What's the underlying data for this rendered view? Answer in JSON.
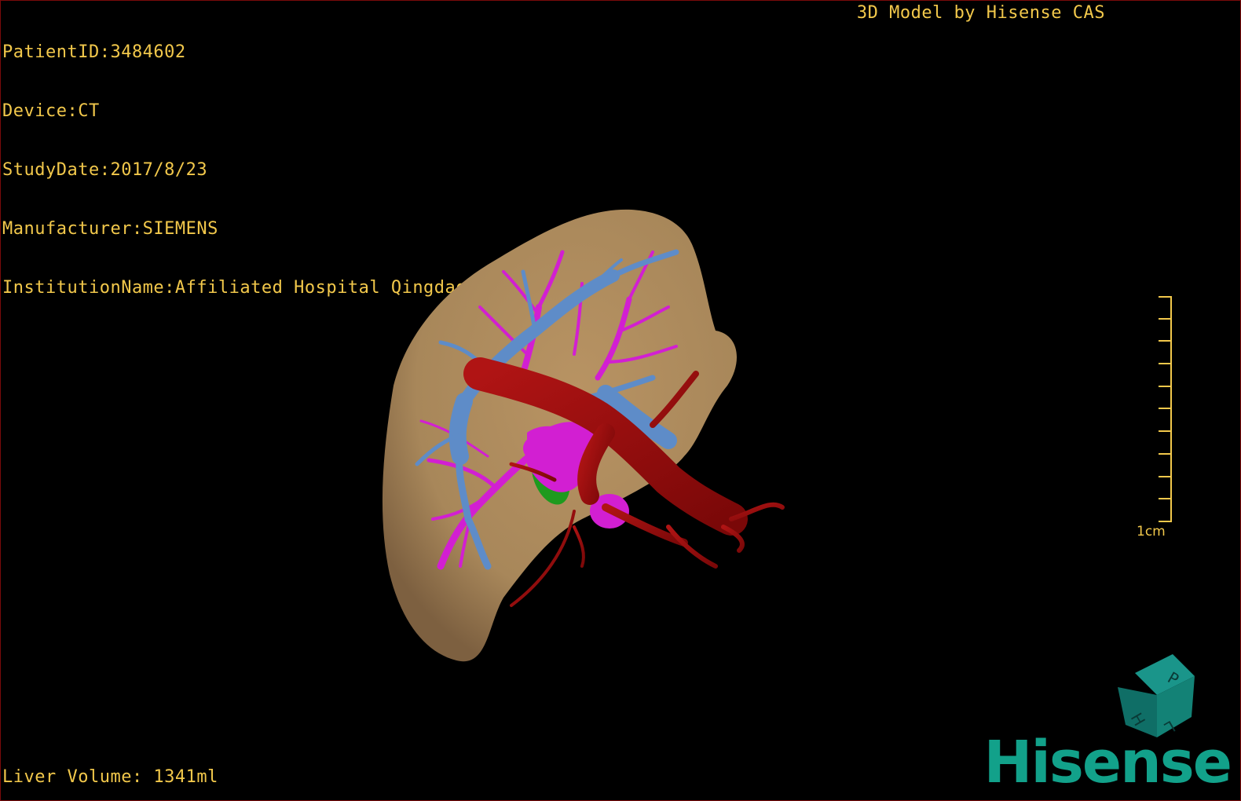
{
  "patient": {
    "patient_id": "PatientID:3484602",
    "device": "Device:CT",
    "study_date": "StudyDate:2017/8/23",
    "manufacturer": "Manufacturer:SIEMENS",
    "institution": "InstitutionName:Affiliated Hospital Qingdao University-C"
  },
  "header": {
    "brand_title": "3D Model by Hisense CAS"
  },
  "footer": {
    "liver_volume": "Liver Volume: 1341ml"
  },
  "scale": {
    "label": "1cm"
  },
  "orientation_cube": {
    "face_top": "P",
    "face_left": "H",
    "face_right": "L"
  },
  "logo": {
    "text": "Hisense"
  },
  "colors": {
    "overlay_text": "#f2c84b",
    "liver": "#a8875a",
    "artery": "#9b0d0d",
    "portal_vein": "#d21fd2",
    "hepatic_vein": "#5e8cc8",
    "gallbladder": "#1e9a1e",
    "cube": "#117a72",
    "logo": "#12a18a"
  }
}
